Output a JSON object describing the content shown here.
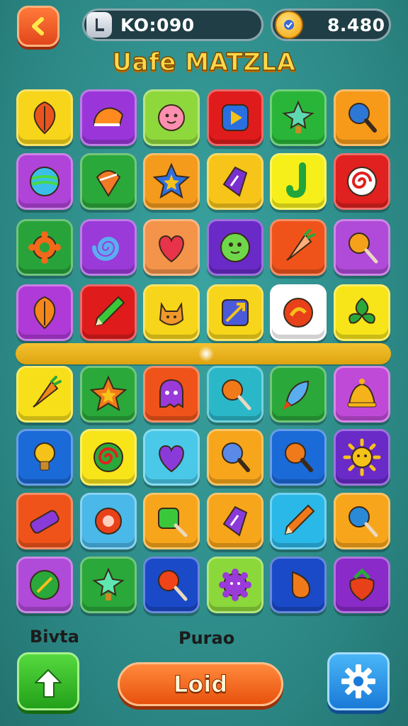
{
  "header": {
    "score_label": "KO:090",
    "coins": "8.480",
    "title": "Uafe MATZLA",
    "back_icon": "chevron-left-icon",
    "score_icon": "trophy-icon",
    "coin_icon": "coin-icon"
  },
  "board": {
    "rows": [
      [
        {
          "name": "maple-leaf-tile",
          "bg": "#f7d51a",
          "icon": "leaf-icon",
          "color": "#e9541e"
        },
        {
          "name": "cake-slice-tile",
          "bg": "#9a36d9",
          "icon": "cake-icon",
          "color": "#ff8a1f"
        },
        {
          "name": "smiley-flower-tile",
          "bg": "#8fd83c",
          "icon": "flower-icon",
          "color": "#ff8fb0"
        },
        {
          "name": "play-gem-tile",
          "bg": "#e01b1b",
          "icon": "play-icon",
          "color": "#2a6fe0"
        },
        {
          "name": "star-bulb-tile",
          "bg": "#29b638",
          "icon": "star-bulb-icon",
          "color": "#5ed8b0"
        },
        {
          "name": "magnifier-tile",
          "bg": "#f79a1a",
          "icon": "magnifier-icon",
          "color": "#2d78d6"
        }
      ],
      [
        {
          "name": "planet-tile",
          "bg": "#b043d8",
          "icon": "planet-icon",
          "color": "#3ac0e8"
        },
        {
          "name": "top-tile",
          "bg": "#2aa83a",
          "icon": "top-icon",
          "color": "#f07a25"
        },
        {
          "name": "star-tile",
          "bg": "#f49b1c",
          "icon": "star-icon",
          "color": "#2f6fe0"
        },
        {
          "name": "purple-gem-tile",
          "bg": "#f7c51a",
          "icon": "gem-icon",
          "color": "#7a2fd0"
        },
        {
          "name": "hook-tile",
          "bg": "#f7ef1a",
          "icon": "hook-icon",
          "color": "#22a53a"
        },
        {
          "name": "swirl-candy-tile",
          "bg": "#e0211f",
          "icon": "swirl-icon",
          "color": "#ffffff"
        }
      ],
      [
        {
          "name": "gear-flower-tile",
          "bg": "#27a33a",
          "icon": "cog-flower-icon",
          "color": "#f06a1a"
        },
        {
          "name": "spiral-tile",
          "bg": "#9a3ad8",
          "icon": "spiral-icon",
          "color": "#5aaef0"
        },
        {
          "name": "heart-bolt-tile",
          "bg": "#f4934a",
          "icon": "heart-icon",
          "color": "#e8334a"
        },
        {
          "name": "green-blob-tile",
          "bg": "#6a2ac8",
          "icon": "blob-icon",
          "color": "#6ed84a"
        },
        {
          "name": "carrot-tile",
          "bg": "#f0531a",
          "icon": "carrot-icon",
          "color": "#ffb07a"
        },
        {
          "name": "ice-pop-tile",
          "bg": "#b04ad8",
          "icon": "lollipop-icon",
          "color": "#f5a21a"
        }
      ],
      [
        {
          "name": "orange-leaf-tile",
          "bg": "#b03ad8",
          "icon": "leaf-icon",
          "color": "#f5871a"
        },
        {
          "name": "pencil-tile",
          "bg": "#e01b1b",
          "icon": "pencil-icon",
          "color": "#3ac83a"
        },
        {
          "name": "cat-face-tile",
          "bg": "#f7d51a",
          "icon": "cat-icon",
          "color": "#f0982a"
        },
        {
          "name": "arrow-gem-tile",
          "bg": "#f7d51a",
          "icon": "arrow-icon",
          "color": "#4a5ad8"
        },
        {
          "name": "fire-ball-tile",
          "bg": "#ffffff",
          "icon": "ball-icon",
          "color": "#e8411a"
        },
        {
          "name": "clover-leaf-tile",
          "bg": "#f7e51a",
          "icon": "clover-icon",
          "color": "#2aa83a"
        }
      ],
      [
        {
          "name": "carrot-root-tile",
          "bg": "#f7e01a",
          "icon": "carrot-icon",
          "color": "#f0881a"
        },
        {
          "name": "orange-star-tile",
          "bg": "#2aa83a",
          "icon": "star-icon",
          "color": "#f07a1a"
        },
        {
          "name": "purple-ghost-tile",
          "bg": "#f0531a",
          "icon": "ghost-icon",
          "color": "#9a3ad8"
        },
        {
          "name": "orange-lollipop-tile",
          "bg": "#2ab8c8",
          "icon": "lollipop-icon",
          "color": "#f07a1a"
        },
        {
          "name": "shuttle-tile",
          "bg": "#2aa83a",
          "icon": "shuttle-icon",
          "color": "#5aaef0"
        },
        {
          "name": "bell-tile",
          "bg": "#c04ad8",
          "icon": "bell-icon",
          "color": "#f5b21a"
        }
      ],
      [
        {
          "name": "bulb-tile",
          "bg": "#1a6ad8",
          "icon": "bulb-icon",
          "color": "#f5c21a"
        },
        {
          "name": "green-swirl-tile",
          "bg": "#f7e51a",
          "icon": "swirl-icon",
          "color": "#2aa83a"
        },
        {
          "name": "purple-heart-tile",
          "bg": "#4ac8e8",
          "icon": "heart-icon",
          "color": "#8a3ad8"
        },
        {
          "name": "blue-magnifier-tile",
          "bg": "#f7a51a",
          "icon": "magnifier-icon",
          "color": "#5a8ae8"
        },
        {
          "name": "orange-magnifier-tile",
          "bg": "#1a6ad8",
          "icon": "magnifier-icon",
          "color": "#f07a1a"
        },
        {
          "name": "sun-face-tile",
          "bg": "#6a2ac8",
          "icon": "sun-icon",
          "color": "#f5c21a"
        }
      ],
      [
        {
          "name": "purple-bar-tile",
          "bg": "#f0531a",
          "icon": "bar-icon",
          "color": "#8a3ad8"
        },
        {
          "name": "red-ring-tile",
          "bg": "#4ab8e8",
          "icon": "ring-icon",
          "color": "#e8411a"
        },
        {
          "name": "green-key-tile",
          "bg": "#f7a51a",
          "icon": "key-icon",
          "color": "#3ac83a"
        },
        {
          "name": "purple-gem-square-tile",
          "bg": "#f7a51a",
          "icon": "gem-icon",
          "color": "#8a3ad8"
        },
        {
          "name": "orange-pencil-tile",
          "bg": "#2ab8e8",
          "icon": "pencil-icon",
          "color": "#f07a1a"
        },
        {
          "name": "blue-candy-tile",
          "bg": "#f7a51a",
          "icon": "lollipop-icon",
          "color": "#2a8ad8"
        }
      ],
      [
        {
          "name": "flag-gem-tile",
          "bg": "#b04ad8",
          "icon": "flag-icon",
          "color": "#2aa83a"
        },
        {
          "name": "green-star-bulb-tile",
          "bg": "#2aa83a",
          "icon": "star-bulb-icon",
          "color": "#5ee8b0"
        },
        {
          "name": "red-candy-tile",
          "bg": "#1a4ac8",
          "icon": "lollipop-icon",
          "color": "#f0431a"
        },
        {
          "name": "purple-gear-tile",
          "bg": "#8ad83a",
          "icon": "cog-icon",
          "color": "#9a3ad8"
        },
        {
          "name": "orange-drop-tile",
          "bg": "#1a4ac8",
          "icon": "drop-icon",
          "color": "#f07a1a"
        },
        {
          "name": "strawberry-tile",
          "bg": "#8a2ac8",
          "icon": "berry-icon",
          "color": "#e8411a"
        }
      ]
    ]
  },
  "footer": {
    "left_label": "Bivta",
    "center_label": "Purao",
    "main_button": "Loid",
    "left_button_icon": "arrow-up-icon",
    "settings_icon": "gear-icon"
  }
}
